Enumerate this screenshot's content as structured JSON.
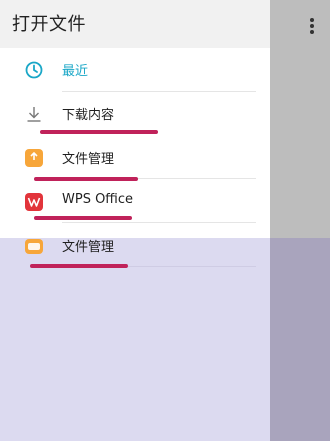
{
  "drawer": {
    "title": "打开文件",
    "items": [
      {
        "label": "最近",
        "icon": "clock-icon"
      },
      {
        "label": "下载内容",
        "icon": "download-icon"
      },
      {
        "label": "文件管理",
        "icon": "file-manager-icon"
      },
      {
        "label": "WPS Office",
        "icon": "wps-icon"
      },
      {
        "label": "文件管理",
        "icon": "file-manager-icon"
      }
    ]
  },
  "colors": {
    "accent": "#1aa7c7",
    "annotation": "#c0225a",
    "lower_overlay": "#dcdaf0"
  }
}
